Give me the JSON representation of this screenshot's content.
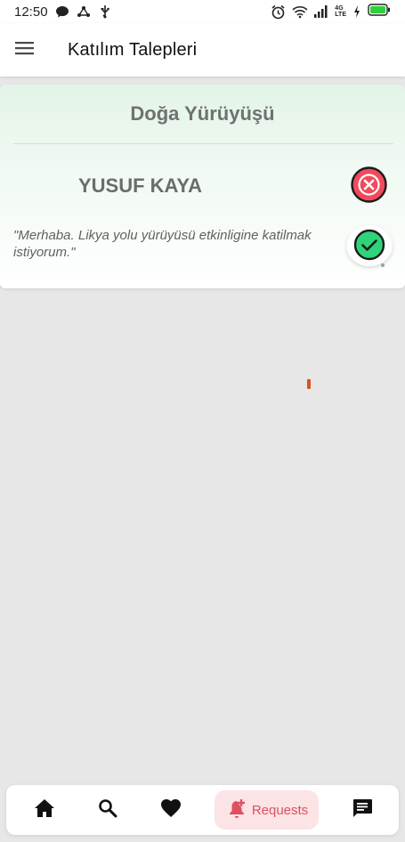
{
  "status_bar": {
    "time": "12:50",
    "left_icons": [
      "chat-bubble-icon",
      "share-node-icon",
      "usb-icon"
    ],
    "right_icons": [
      "alarm-icon",
      "wifi-icon",
      "signal-icon",
      "network-4g-lte-icon",
      "charging-bolt-icon",
      "battery-icon"
    ],
    "network_top": "4G",
    "network_bottom": "LTE"
  },
  "app_bar": {
    "menu_icon": "menu-icon",
    "title": "Katılım Talepleri"
  },
  "request_card": {
    "event_title": "Doğa Yürüyüşü",
    "user_name": "YUSUF KAYA",
    "message": "\"Merhaba. Likya yolu yürüyüsü etkinligine katilmak istiyorum.\"",
    "reject_icon": "close-circle-icon",
    "accept_icon": "check-circle-icon"
  },
  "bottom_nav": {
    "items": [
      {
        "icon": "home-icon"
      },
      {
        "icon": "search-icon"
      },
      {
        "icon": "heart-icon"
      },
      {
        "icon": "bell-plus-icon",
        "label": "Requests"
      },
      {
        "icon": "message-icon"
      }
    ]
  },
  "colors": {
    "accent": "#e0505f",
    "accent_bg": "#fbe3e6",
    "accept_green": "#2fd37a",
    "reject_red": "#f24a5c",
    "card_gradient_top": "#e3f4e8",
    "page_bg": "#e6e7e6"
  }
}
